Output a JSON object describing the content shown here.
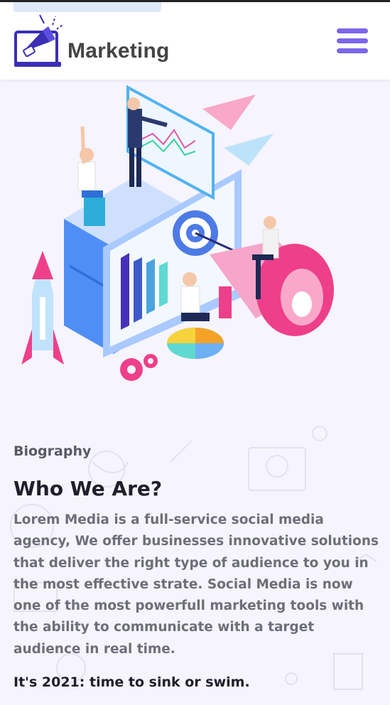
{
  "header": {
    "brand": "Marketing",
    "logo_icon": "megaphone-laptop-icon",
    "menu_icon": "hamburger-menu-icon"
  },
  "hero": {
    "illustration": "marketing-team-illustration"
  },
  "about": {
    "eyebrow": "Biography",
    "title": "Who We Are?",
    "description": "Lorem Media is a full-service social media agency, We offer businesses innovative solutions that deliver the right type of audience to you in the most effective strate. Social Media is now one of the most powerfull marketing tools with the ability to communicate with a target audience in real time.",
    "tagline": "It's 2021: time to sink or swim."
  },
  "colors": {
    "accent": "#7b67ea",
    "logo_blue": "#3a2fb5",
    "background": "#f6f4fd",
    "title": "#1f1f2b",
    "body_text": "#6d6f77",
    "pink": "#f2569b"
  }
}
